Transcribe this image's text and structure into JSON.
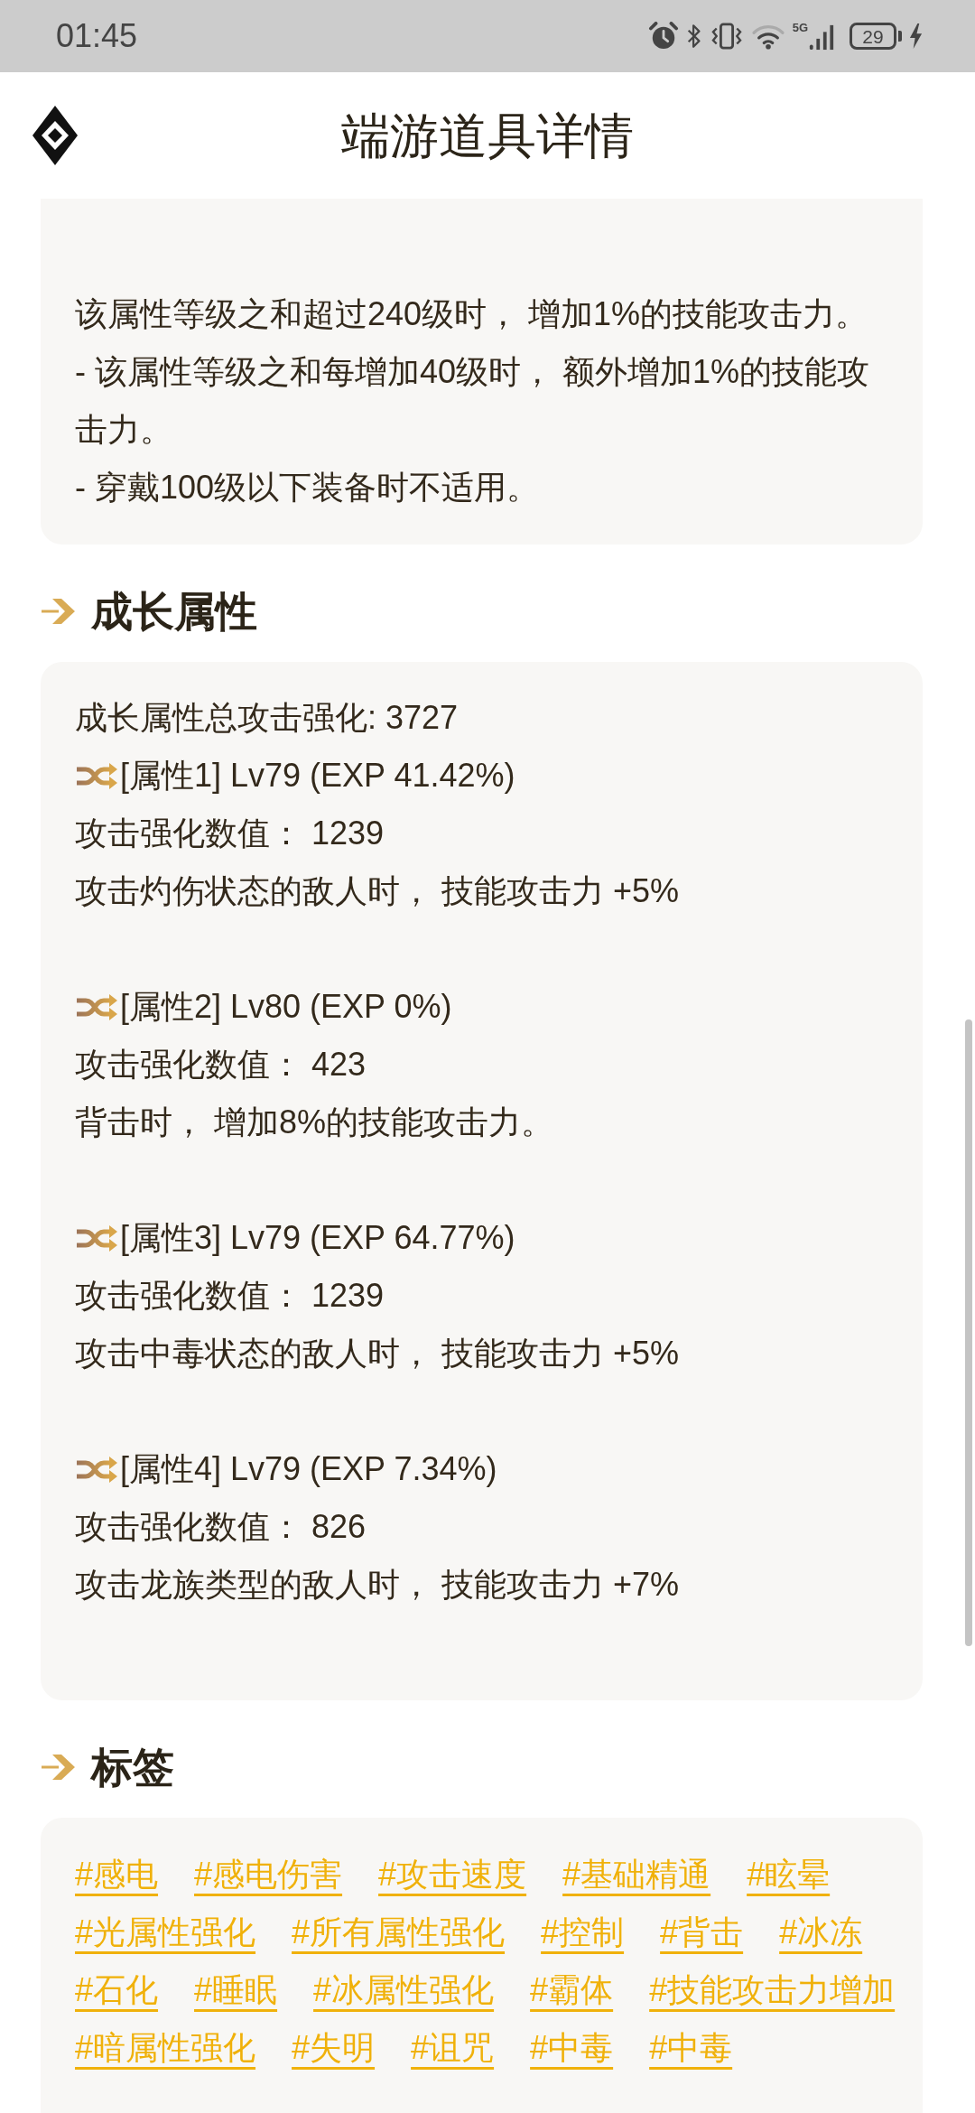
{
  "status_bar": {
    "time": "01:45",
    "network_type": "5G",
    "battery": "29",
    "charging": true
  },
  "header": {
    "title": "端游道具详情"
  },
  "sections": [
    {
      "kind": "text",
      "lines": [
        "该属性等级之和超过240级时， 增加1%的技能攻击力。",
        "- 该属性等级之和每增加40级时， 额外增加1%的技能攻击力。",
        "- 穿戴100级以下装备时不适用。"
      ]
    },
    {
      "kind": "growth",
      "title": "成长属性",
      "total": "成长属性总攻击强化: 3727",
      "attributes": [
        {
          "heading": "[属性1] Lv79 (EXP 41.42%)",
          "value": "攻击强化数值： 1239",
          "effect": "攻击灼伤状态的敌人时， 技能攻击力 +5%"
        },
        {
          "heading": "[属性2] Lv80 (EXP 0%)",
          "value": "攻击强化数值： 423",
          "effect": "背击时， 增加8%的技能攻击力。"
        },
        {
          "heading": "[属性3] Lv79 (EXP 64.77%)",
          "value": "攻击强化数值： 1239",
          "effect": "攻击中毒状态的敌人时， 技能攻击力 +5%"
        },
        {
          "heading": "[属性4] Lv79 (EXP 7.34%)",
          "value": "攻击强化数值： 826",
          "effect": "攻击龙族类型的敌人时， 技能攻击力 +7%"
        }
      ]
    },
    {
      "kind": "tags",
      "title": "标签",
      "tags": [
        "#感电",
        "#感电伤害",
        "#攻击速度",
        "#基础精通",
        "#眩晕",
        "#光属性强化",
        "#所有属性强化",
        "#控制",
        "#背击",
        "#冰冻",
        "#石化",
        "#睡眠",
        "#冰属性强化",
        "#霸体",
        "#技能攻击力增加",
        "#暗属性强化",
        "#失明",
        "#诅咒",
        "#中毒",
        "#中毒"
      ]
    }
  ]
}
